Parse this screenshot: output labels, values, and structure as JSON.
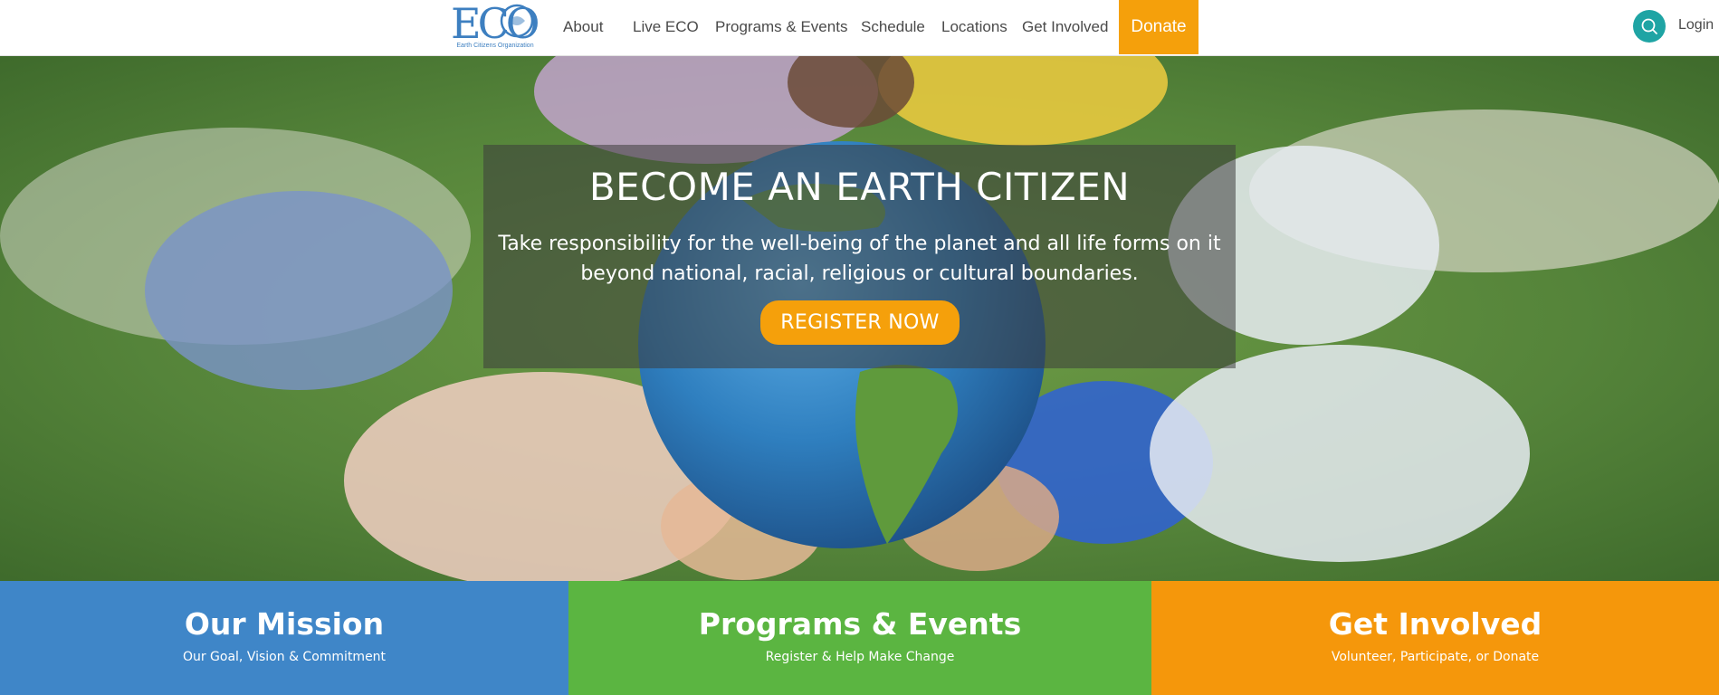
{
  "brand": {
    "logo_text": "ECO",
    "logo_caption": "Earth Citizens Organization"
  },
  "nav": {
    "items": [
      "About",
      "Live ECO",
      "Programs & Events",
      "Schedule",
      "Locations",
      "Get Involved"
    ],
    "donate_label": "Donate",
    "login_label": "Login",
    "search_icon": "search-icon"
  },
  "hero": {
    "title": "BECOME AN EARTH CITIZEN",
    "subtitle_line1": "Take responsibility for the well-being of the planet and all life forms on it",
    "subtitle_line2": "beyond national, racial, religious or cultural boundaries.",
    "cta_label": "REGISTER NOW"
  },
  "tiles": [
    {
      "title": "Our Mission",
      "subtitle": "Our Goal, Vision & Commitment",
      "color": "#3f86c8"
    },
    {
      "title": "Programs & Events",
      "subtitle": "Register & Help Make Change",
      "color": "#5bb541"
    },
    {
      "title": "Get Involved",
      "subtitle": "Volunteer, Participate, or Donate",
      "color": "#f5970b"
    }
  ],
  "colors": {
    "accent_orange": "#f5a00b",
    "teal": "#1fa4a4",
    "nav_text": "#4a4a4a"
  }
}
